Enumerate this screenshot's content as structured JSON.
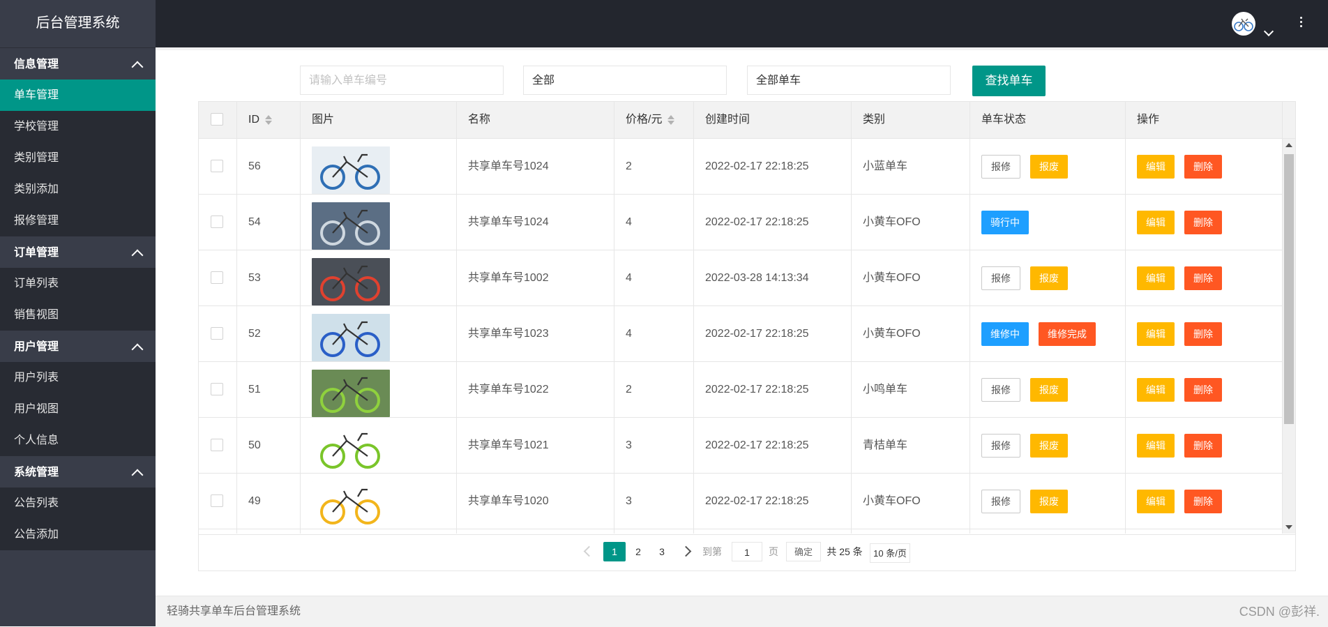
{
  "brand": "后台管理系统",
  "sidebar": {
    "groups": [
      {
        "title": "信息管理",
        "items": [
          "单车管理",
          "学校管理",
          "类别管理",
          "类别添加",
          "报修管理"
        ]
      },
      {
        "title": "订单管理",
        "items": [
          "订单列表",
          "销售视图"
        ]
      },
      {
        "title": "用户管理",
        "items": [
          "用户列表",
          "用户视图",
          "个人信息"
        ]
      },
      {
        "title": "系统管理",
        "items": [
          "公告列表",
          "公告添加"
        ]
      }
    ],
    "active_item": "单车管理"
  },
  "search": {
    "bike_no_placeholder": "请输入单车编号",
    "school_select": "全部",
    "type_select": "全部单车",
    "find_button": "查找单车"
  },
  "table": {
    "headers": {
      "id": "ID",
      "image": "图片",
      "name": "名称",
      "price": "价格/元",
      "created": "创建时间",
      "category": "类别",
      "status": "单车状态",
      "actions": "操作"
    },
    "rows": [
      {
        "id": "56",
        "name": "共享单车号1024",
        "price": "2",
        "created": "2022-02-17 22:18:25",
        "category": "小蓝单车",
        "status_buttons": [
          "报修",
          "报废"
        ]
      },
      {
        "id": "54",
        "name": "共享单车号1024",
        "price": "4",
        "created": "2022-02-17 22:18:25",
        "category": "小黄车OFO",
        "status_buttons": [
          "骑行中"
        ]
      },
      {
        "id": "53",
        "name": "共享单车号1002",
        "price": "4",
        "created": "2022-03-28 14:13:34",
        "category": "小黄车OFO",
        "status_buttons": [
          "报修",
          "报废"
        ]
      },
      {
        "id": "52",
        "name": "共享单车号1023",
        "price": "4",
        "created": "2022-02-17 22:18:25",
        "category": "小黄车OFO",
        "status_buttons": [
          "维修中",
          "维修完成"
        ]
      },
      {
        "id": "51",
        "name": "共享单车号1022",
        "price": "2",
        "created": "2022-02-17 22:18:25",
        "category": "小鸣单车",
        "status_buttons": [
          "报修",
          "报废"
        ]
      },
      {
        "id": "50",
        "name": "共享单车号1021",
        "price": "3",
        "created": "2022-02-17 22:18:25",
        "category": "青桔单车",
        "status_buttons": [
          "报修",
          "报废"
        ]
      },
      {
        "id": "49",
        "name": "共享单车号1020",
        "price": "3",
        "created": "2022-02-17 22:18:25",
        "category": "小黄车OFO",
        "status_buttons": [
          "报修",
          "报废"
        ]
      }
    ],
    "edit_label": "编辑",
    "delete_label": "删除"
  },
  "pager": {
    "pages": [
      "1",
      "2",
      "3"
    ],
    "current": "1",
    "goto_label": "到第",
    "goto_value": "1",
    "page_unit": "页",
    "confirm": "确定",
    "total": "共 25 条",
    "per_page": "10 条/页"
  },
  "footer": {
    "left": "轻骑共享单车后台管理系统",
    "right": "CSDN @彭祥."
  },
  "colors": {
    "accent": "#009688",
    "warn": "#ffb800",
    "danger": "#ff5722",
    "normal": "#1e9fff",
    "sidebar": "#393d49",
    "header": "#23262e"
  }
}
